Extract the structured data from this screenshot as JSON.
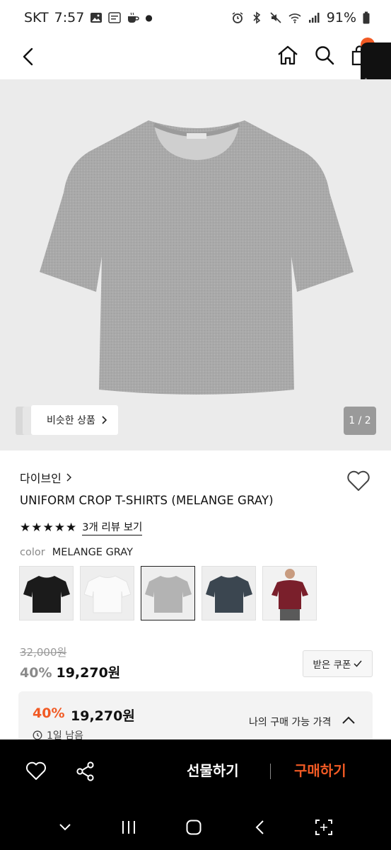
{
  "status_bar": {
    "carrier": "SKT",
    "time": "7:57",
    "battery": "91%"
  },
  "header": {
    "cart_count": ""
  },
  "hero": {
    "similar_label": "비슷한 상품",
    "page_indicator": "1 / 2"
  },
  "product": {
    "brand": "다이브인",
    "name": "UNIFORM CROP T-SHIRTS (MELANGE GRAY)",
    "rating_stars": 5,
    "review_link": "3개 리뷰 보기",
    "color_label": "color",
    "color_value": "MELANGE GRAY",
    "swatches": [
      {
        "name": "black",
        "color": "#1b1b1b"
      },
      {
        "name": "white",
        "color": "#f7f7f7"
      },
      {
        "name": "melange-gray",
        "color": "#b5b5b5",
        "selected": true
      },
      {
        "name": "navy",
        "color": "#3b4650"
      },
      {
        "name": "burgundy",
        "color": "#7a1f2b"
      }
    ],
    "original_price": "32,000원",
    "discount_rate": "40%",
    "sale_price": "19,270원",
    "coupon_label": "받은 쿠폰"
  },
  "my_price": {
    "discount_rate": "40%",
    "price": "19,270원",
    "label": "나의 구매 가능 가격",
    "timer": "1일 남음"
  },
  "action_bar": {
    "gift_label": "선물하기",
    "buy_label": "구매하기"
  },
  "colors": {
    "accent": "#f15a24",
    "bar_bg": "#000000",
    "hero_bg": "#ebebeb"
  }
}
